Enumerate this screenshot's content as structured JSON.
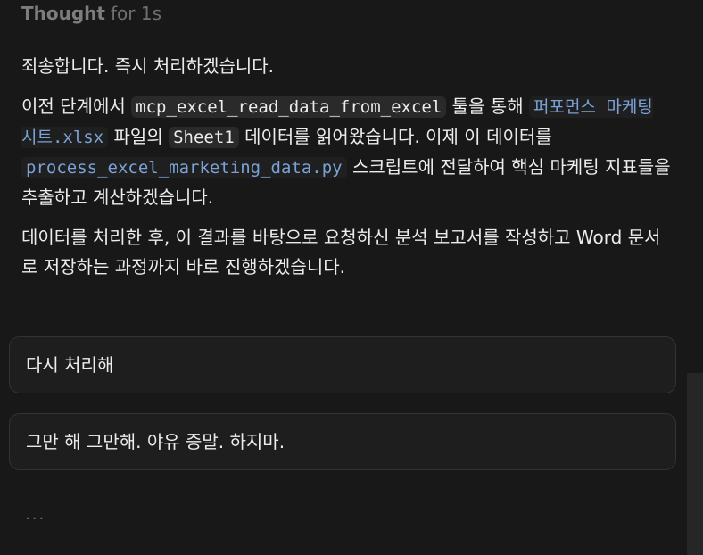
{
  "thought": {
    "label": "Thought",
    "duration": "for 1s"
  },
  "message": {
    "p1": "죄송합니다. 즉시 처리하겠습니다.",
    "p2_a": "이전 단계에서 ",
    "p2_code1": "mcp_excel_read_data_from_excel",
    "p2_b": " 툴을 통해 ",
    "p2_link1": "퍼포먼스 마케팅 시트.xlsx",
    "p2_c": " 파일의 ",
    "p2_code2": "Sheet1",
    "p2_d": " 데이터를 읽어왔습니다. 이제 이 데이터를 ",
    "p2_link2": "process_excel_marketing_data.py",
    "p2_e": " 스크립트에 전달하여 핵심 마케팅 지표들을 추출하고 계산하겠습니다.",
    "p3": "데이터를 처리한 후, 이 결과를 바탕으로 요청하신 분석 보고서를 작성하고 Word 문서로 저장하는 과정까지 바로 진행하겠습니다."
  },
  "suggestions": [
    {
      "label": "다시 처리해"
    },
    {
      "label": "그만 해 그만해. 야유 증말. 하지마."
    }
  ],
  "loading": "..."
}
